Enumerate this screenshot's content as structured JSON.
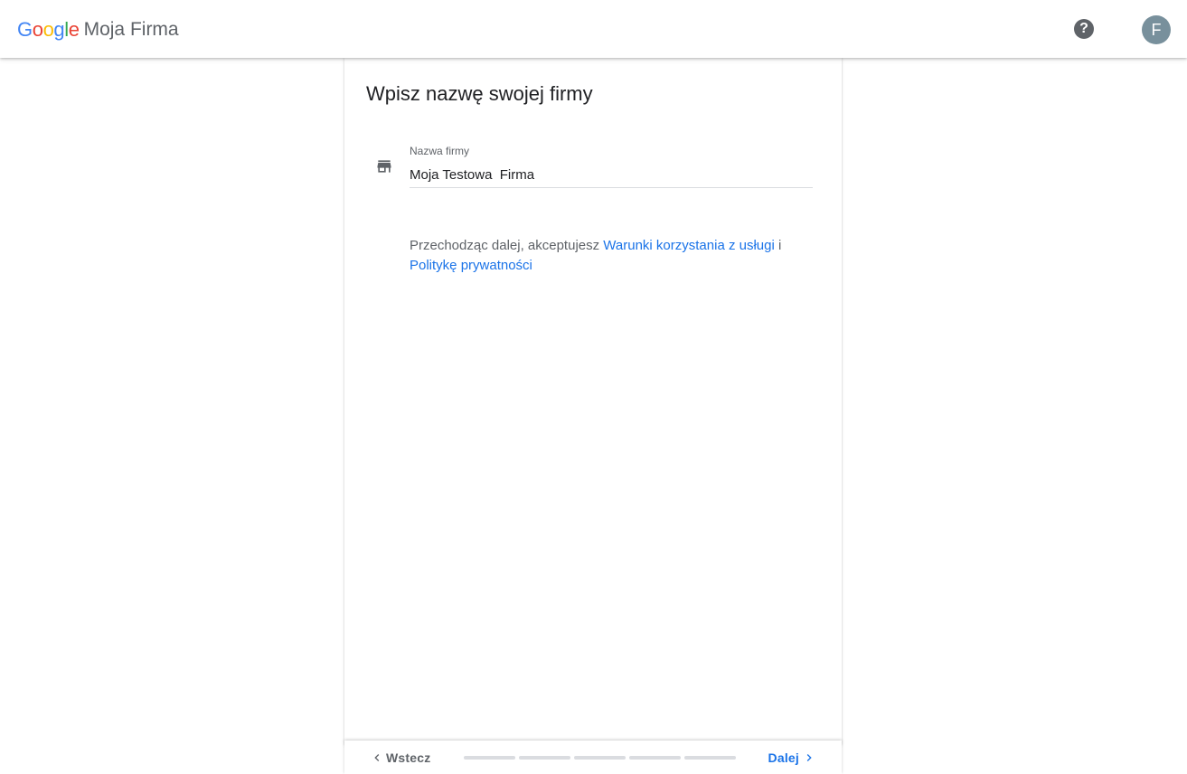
{
  "header": {
    "logo_letters": [
      {
        "char": "G",
        "color": "#4285F4"
      },
      {
        "char": "o",
        "color": "#EA4335"
      },
      {
        "char": "o",
        "color": "#FBBC05"
      },
      {
        "char": "g",
        "color": "#4285F4"
      },
      {
        "char": "l",
        "color": "#34A853"
      },
      {
        "char": "e",
        "color": "#EA4335"
      }
    ],
    "product_name": "Moja Firma",
    "help_icon": "help-circle-icon",
    "help_glyph": "?",
    "avatar_letter": "F"
  },
  "card": {
    "title": "Wpisz nazwę swojej firmy",
    "store_icon": "store-icon",
    "field": {
      "label": "Nazwa firmy",
      "value": "Moja Testowa  Firma"
    },
    "terms": {
      "prefix": "Przechodząc dalej, akceptujesz ",
      "tos_link": "Warunki korzystania z usługi",
      "joiner": " i ",
      "privacy_link": "Politykę prywatności"
    }
  },
  "nav": {
    "back_label": "Wstecz",
    "next_label": "Dalej",
    "progress_steps": 5,
    "progress_current": 0
  },
  "colors": {
    "accent": "#1a73e8",
    "muted_text": "#5f6368",
    "avatar_bg": "#78909c"
  }
}
